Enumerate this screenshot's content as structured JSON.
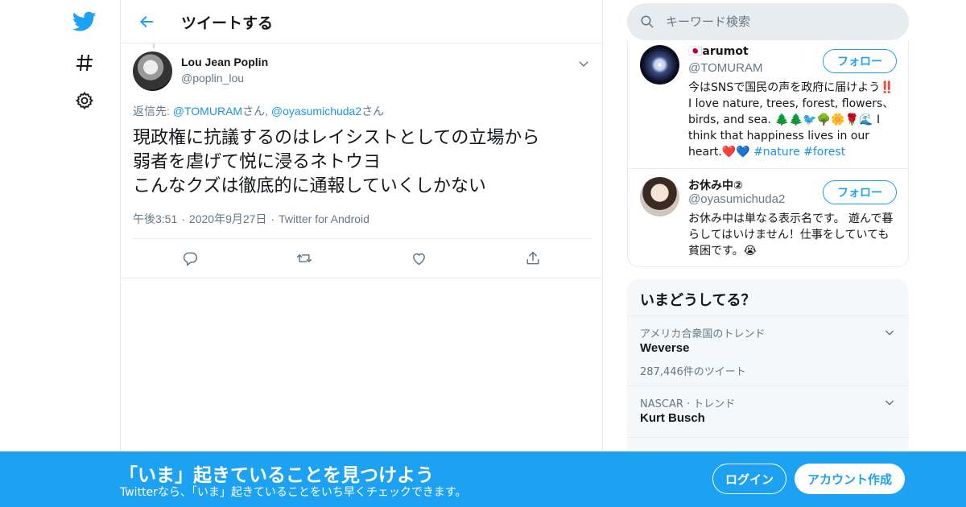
{
  "nav": {
    "icons": [
      "twitter-logo-icon",
      "hashtag-icon",
      "gear-icon"
    ]
  },
  "header": {
    "title": "ツイートする"
  },
  "tweet": {
    "author_name": "Lou Jean Poplin",
    "author_handle": "@poplin_lou",
    "reply_prefix": "返信先: ",
    "reply_user1": "@TOMURAM",
    "reply_suffix1": "さん, ",
    "reply_user2": "@oyasumichuda2",
    "reply_suffix2": "さん",
    "text": "現政権に抗議するのはレイシストとしての立場から\n弱者を虐げて悦に浸るネトウヨ\nこんなクズは徹底的に通報していくしかない",
    "time": "午後3:51",
    "date": "2020年9月27日",
    "source": "Twitter for Android",
    "actions": [
      "reply-icon",
      "retweet-icon",
      "like-icon",
      "share-icon"
    ]
  },
  "search": {
    "placeholder": "キーワード検索"
  },
  "users": [
    {
      "name": "🇯🇵arumot",
      "handle": "@TOMURAM",
      "follow_label": "フォロー",
      "bio": "今はSNSで国民の声を政府に届けよう‼️ I love nature, trees, forest, flowers、birds, and sea. 🌲🌲🐦🌳🌼🌹🌊 I think that happiness lives in our heart.❤️💙 ",
      "tags": "#nature #forest"
    },
    {
      "name": "お休み中②",
      "handle": "@oyasumichuda2",
      "follow_label": "フォロー",
      "bio": "お休み中は単なる表示名です。 遊んで暮らしてはいけません！仕事をしていても貧困です。😭"
    }
  ],
  "trends": {
    "title": "いまどうしてる？",
    "items": [
      {
        "meta": "アメリカ合衆国のトレンド",
        "name": "Weverse",
        "count": "287,446件のツイート"
      },
      {
        "meta": "NASCAR · トレンド",
        "name": "Kurt Busch"
      }
    ]
  },
  "banner": {
    "title": "「いま」起きていることを見つけよう",
    "subtitle": "Twitterなら、「いま」起きていることをいち早くチェックできます。",
    "login_label": "ログイン",
    "signup_label": "アカウント作成"
  },
  "colors": {
    "brand": "#1da1f2",
    "link": "#1b95e0",
    "muted": "#657786"
  }
}
